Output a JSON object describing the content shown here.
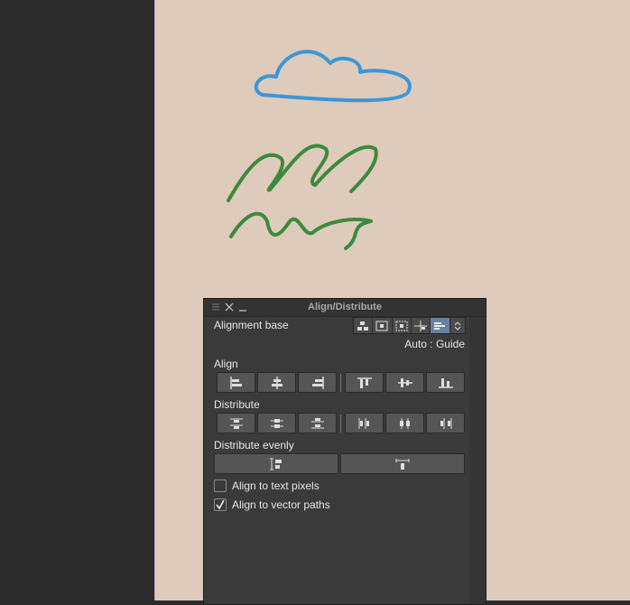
{
  "panel": {
    "title": "Align/Distribute",
    "alignment_base_label": "Alignment base",
    "alignment_base_value": "Auto : Guide",
    "align_label": "Align",
    "distribute_label": "Distribute",
    "distribute_evenly_label": "Distribute evenly",
    "option_text_pixels": "Align to text pixels",
    "option_vector_paths": "Align to vector paths",
    "text_pixels_checked": false,
    "vector_paths_checked": true,
    "alignment_base_selected_index": 4
  },
  "colors": {
    "canvas": "#dfcbbb",
    "cloud": "#3b97d6",
    "scribble": "#3b8a3e",
    "selected": "#6a7fa6"
  },
  "icons": {
    "align": [
      "align-left-icon",
      "align-center-h-icon",
      "align-right-icon",
      "align-top-icon",
      "align-middle-v-icon",
      "align-bottom-icon"
    ],
    "distribute": [
      "distribute-top-icon",
      "distribute-center-v-icon",
      "distribute-bottom-icon",
      "distribute-left-icon",
      "distribute-center-h-icon",
      "distribute-right-icon"
    ],
    "distribute_evenly": [
      "distribute-vertical-spacing-icon",
      "distribute-horizontal-spacing-icon"
    ]
  }
}
